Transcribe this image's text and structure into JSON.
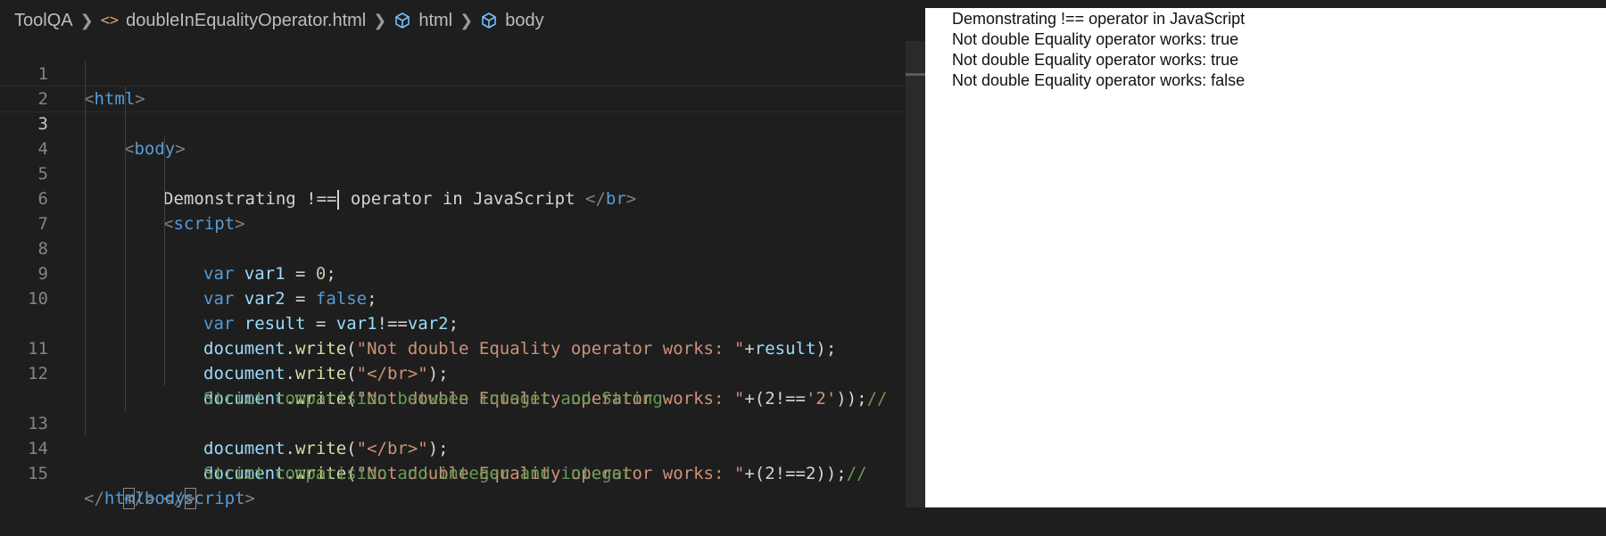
{
  "breadcrumb": {
    "items": [
      "ToolQA",
      "doubleInEqualityOperator.html",
      "html",
      "body"
    ],
    "file_icon": "<>"
  },
  "editor": {
    "line_numbers": [
      "1",
      "2",
      "3",
      "4",
      "5",
      "6",
      "7",
      "8",
      "",
      "9",
      "10",
      "",
      "11",
      "12",
      "",
      "13",
      "14",
      "15"
    ],
    "code_lines": {
      "l1": [
        "<",
        "html",
        ">"
      ],
      "l2": [
        "<",
        "body",
        ">"
      ],
      "l3_text_a": "Demonstrating !==",
      "l3_text_b": " operator in JavaScript ",
      "l3_br": [
        "</",
        "br",
        ">"
      ],
      "l4": [
        "<",
        "script",
        ">"
      ],
      "l5": [
        "var",
        " ",
        "var1",
        " = ",
        "0",
        ";"
      ],
      "l6": [
        "var",
        " ",
        "var2",
        " = ",
        "false",
        ";"
      ],
      "l7": [
        "var",
        " ",
        "result",
        " = ",
        "var1",
        "!==",
        "var2",
        ";"
      ],
      "l8": [
        "document",
        ".",
        "write",
        "(",
        "\"Not double Equality operator works: \"",
        "+",
        "result",
        ");"
      ],
      "l9": [
        "document",
        ".",
        "write",
        "(",
        "\"</br>\"",
        ");"
      ],
      "l10": [
        "document",
        ".",
        "write",
        "(",
        "\"Not double Equality operator works: \"",
        "+(2!==",
        "'2'",
        "));",
        "//"
      ],
      "l10_wrap": "Strict comparision between integer and String",
      "l11": [
        "document",
        ".",
        "write",
        "(",
        "\"</br>\"",
        ");"
      ],
      "l12": [
        "document",
        ".",
        "write",
        "(",
        "\"Not double Equality operator works: \"",
        "+(2!==2));",
        "//"
      ],
      "l12_wrap": "Strict comparision and integer and integer",
      "l13": [
        "</",
        "script",
        ">"
      ],
      "l14": [
        "<",
        "/",
        "body",
        ">"
      ],
      "l15": [
        "</",
        "html",
        ">"
      ]
    }
  },
  "preview": {
    "lines": [
      "Demonstrating !== operator in JavaScript",
      "Not double Equality operator works: true",
      "Not double Equality operator works: true",
      "Not double Equality operator works: false"
    ]
  },
  "colors": {
    "background": "#1e1e1e",
    "tag": "#569cd6",
    "string": "#ce9178",
    "comment": "#6a9955",
    "variable": "#9cdcfe",
    "function": "#dcdcaa",
    "number": "#b5cea8"
  },
  "icons": [
    "chevron-right-icon",
    "code-file-icon",
    "cube-icon"
  ]
}
